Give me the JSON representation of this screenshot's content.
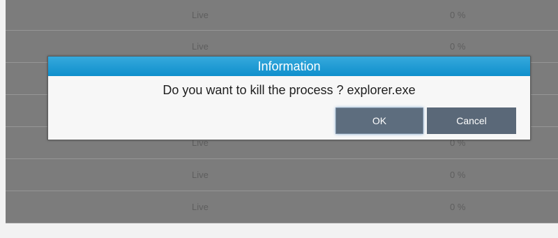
{
  "process_rows": [
    {
      "status": "Live",
      "cpu": "0 %"
    },
    {
      "status": "Live",
      "cpu": "0 %"
    },
    {
      "status": "",
      "cpu": ""
    },
    {
      "status": "",
      "cpu": ""
    },
    {
      "status": "Live",
      "cpu": "0 %"
    },
    {
      "status": "Live",
      "cpu": "0 %"
    },
    {
      "status": "Live",
      "cpu": "0 %"
    }
  ],
  "dialog": {
    "title": "Information",
    "message": "Do you want to kill the process ? explorer.exe",
    "ok_label": "OK",
    "cancel_label": "Cancel"
  },
  "colors": {
    "dialog_header": "#1a9ad6",
    "row_background": "#7c7c7c",
    "button": "#5d6d7e"
  }
}
